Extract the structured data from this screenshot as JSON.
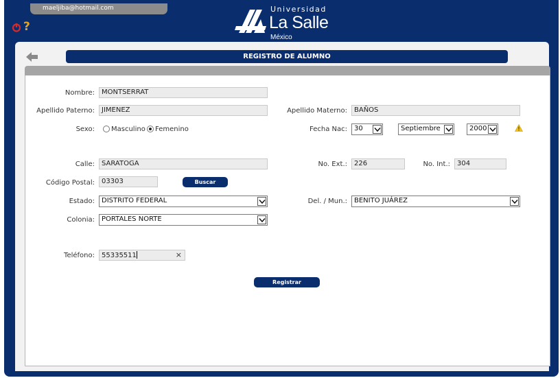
{
  "header": {
    "user_email": "maeljiba@hotmail.com",
    "help_glyph": "?",
    "logo": {
      "top_line": "Universidad",
      "name": "La Salle",
      "sub": "México"
    }
  },
  "page": {
    "title": "REGISTRO DE ALUMNO"
  },
  "form": {
    "nombre": {
      "label": "Nombre:",
      "value": "MONTSERRAT"
    },
    "apellido_paterno": {
      "label": "Apellido Paterno:",
      "value": "JIMENEZ"
    },
    "apellido_materno": {
      "label": "Apellido Materno:",
      "value": "BAÑOS"
    },
    "sexo": {
      "label": "Sexo:",
      "option_m": "Masculino",
      "option_f": "Femenino",
      "selected": "Femenino"
    },
    "fecha_nac": {
      "label": "Fecha Nac:",
      "day": "30",
      "month": "Septiembre",
      "year": "2000"
    },
    "calle": {
      "label": "Calle:",
      "value": "SARATOGA"
    },
    "no_ext": {
      "label": "No. Ext.:",
      "value": "226"
    },
    "no_int": {
      "label": "No. Int.:",
      "value": "304"
    },
    "codigo_postal": {
      "label": "Código Postal:",
      "value": "03303"
    },
    "buscar_label": "Buscar",
    "estado": {
      "label": "Estado:",
      "value": "DISTRITO FEDERAL"
    },
    "del_mun": {
      "label": "Del. / Mun.:",
      "value": "BENITO JUÁREZ"
    },
    "colonia": {
      "label": "Colonia:",
      "value": "PORTALES NORTE"
    },
    "telefono": {
      "label": "Teléfono:",
      "value": "55335511",
      "clear_glyph": "×"
    },
    "registrar_label": "Registrar"
  },
  "colors": {
    "navy": "#0a2d6e",
    "warning": "#f0c020",
    "help": "#e8a21a",
    "power": "#d42a2a"
  }
}
